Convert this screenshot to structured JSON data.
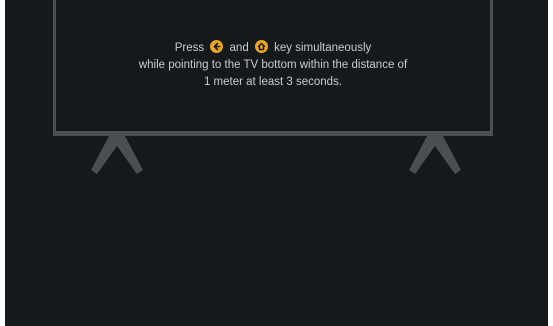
{
  "instruction": {
    "press_prefix": "Press",
    "and_word": "and",
    "key_suffix": "key simultaneously",
    "line2": "while pointing to the TV bottom within the distance of",
    "line3": "1 meter at least 3 seconds."
  },
  "icons": {
    "back_key": "back-arrow-icon",
    "home_key": "home-icon",
    "key_color": "#e8a524"
  },
  "colors": {
    "background": "#15191c",
    "tv_outline": "#4b4f53",
    "text": "#c9cbcd"
  }
}
